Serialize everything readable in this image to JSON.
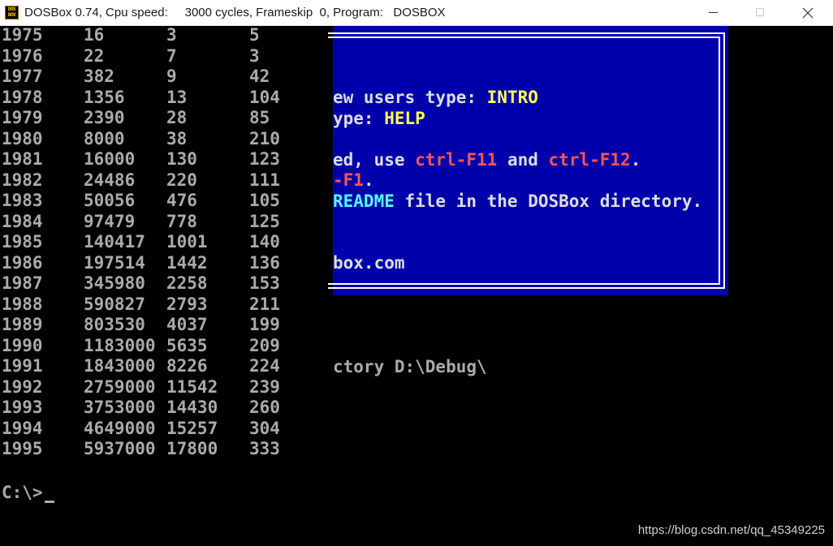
{
  "window": {
    "title": "DOSBox 0.74, Cpu speed:     3000 cycles, Frameskip  0, Program:   DOSBOX",
    "icon_top": "DOS",
    "icon_bottom": "BOX"
  },
  "table_rows": [
    [
      "1975",
      "16",
      "3",
      "5"
    ],
    [
      "1976",
      "22",
      "7",
      "3"
    ],
    [
      "1977",
      "382",
      "9",
      "42"
    ],
    [
      "1978",
      "1356",
      "13",
      "104"
    ],
    [
      "1979",
      "2390",
      "28",
      "85"
    ],
    [
      "1980",
      "8000",
      "38",
      "210"
    ],
    [
      "1981",
      "16000",
      "130",
      "123"
    ],
    [
      "1982",
      "24486",
      "220",
      "111"
    ],
    [
      "1983",
      "50056",
      "476",
      "105"
    ],
    [
      "1984",
      "97479",
      "778",
      "125"
    ],
    [
      "1985",
      "140417",
      "1001",
      "140"
    ],
    [
      "1986",
      "197514",
      "1442",
      "136"
    ],
    [
      "1987",
      "345980",
      "2258",
      "153"
    ],
    [
      "1988",
      "590827",
      "2793",
      "211"
    ],
    [
      "1989",
      "803530",
      "4037",
      "199"
    ],
    [
      "1990",
      "1183000",
      "5635",
      "209"
    ],
    [
      "1991",
      "1843000",
      "8226",
      "224"
    ],
    [
      "1992",
      "2759000",
      "11542",
      "239"
    ],
    [
      "1993",
      "3753000",
      "14430",
      "260"
    ],
    [
      "1994",
      "4649000",
      "15257",
      "304"
    ],
    [
      "1995",
      "5937000",
      "17800",
      "333"
    ]
  ],
  "welcome": {
    "line1_a": "ew users type: ",
    "line1_b": "INTRO",
    "line2_a": "ype: ",
    "line2_b": "HELP",
    "line3_a": "ed, use ",
    "line3_b": "ctrl-F11",
    "line3_c": " and ",
    "line3_d": "ctrl-F12",
    "line3_e": ".",
    "line4_a": "-F1",
    "line4_b": ".",
    "line5_a": "README",
    "line5_b": " file in the DOSBox directory.",
    "line6": "box.com"
  },
  "directory_line": "ctory D:\\Debug\\",
  "prompt": "C:\\>",
  "watermark": "https://blog.csdn.net/qq_45349225",
  "colors": {
    "dos_background": "#000000",
    "dos_text": "#aaaaaa",
    "welcome_bg": "#0000aa",
    "highlight_yellow": "#ffff55",
    "highlight_red": "#ff5555",
    "highlight_cyan": "#55ffff"
  }
}
